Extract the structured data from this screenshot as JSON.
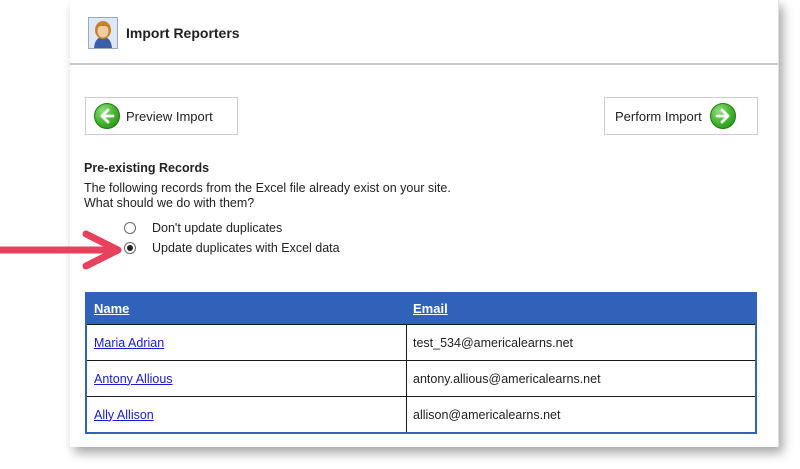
{
  "header": {
    "title": "Import Reporters",
    "icon": "user-avatar-icon"
  },
  "buttons": {
    "preview_label": "Preview Import",
    "perform_label": "Perform Import",
    "accent_color": "#3fb02a"
  },
  "preexisting": {
    "title": "Pre-existing Records",
    "description_line1": "The following records from the Excel file already exist on your site.",
    "description_line2": "What should we do with them?",
    "options": [
      {
        "label": "Don't update duplicates",
        "checked": false
      },
      {
        "label": "Update duplicates with Excel data",
        "checked": true
      }
    ]
  },
  "annotation": {
    "arrow_color": "#e8415e"
  },
  "table": {
    "header_color": "#2f62b8",
    "columns": [
      "Name",
      "Email"
    ],
    "rows": [
      {
        "name": "Maria Adrian",
        "email": "test_534@americalearns.net"
      },
      {
        "name": "Antony Allious",
        "email": "antony.allious@americalearns.net"
      },
      {
        "name": "Ally Allison",
        "email": "allison@americalearns.net"
      }
    ]
  }
}
